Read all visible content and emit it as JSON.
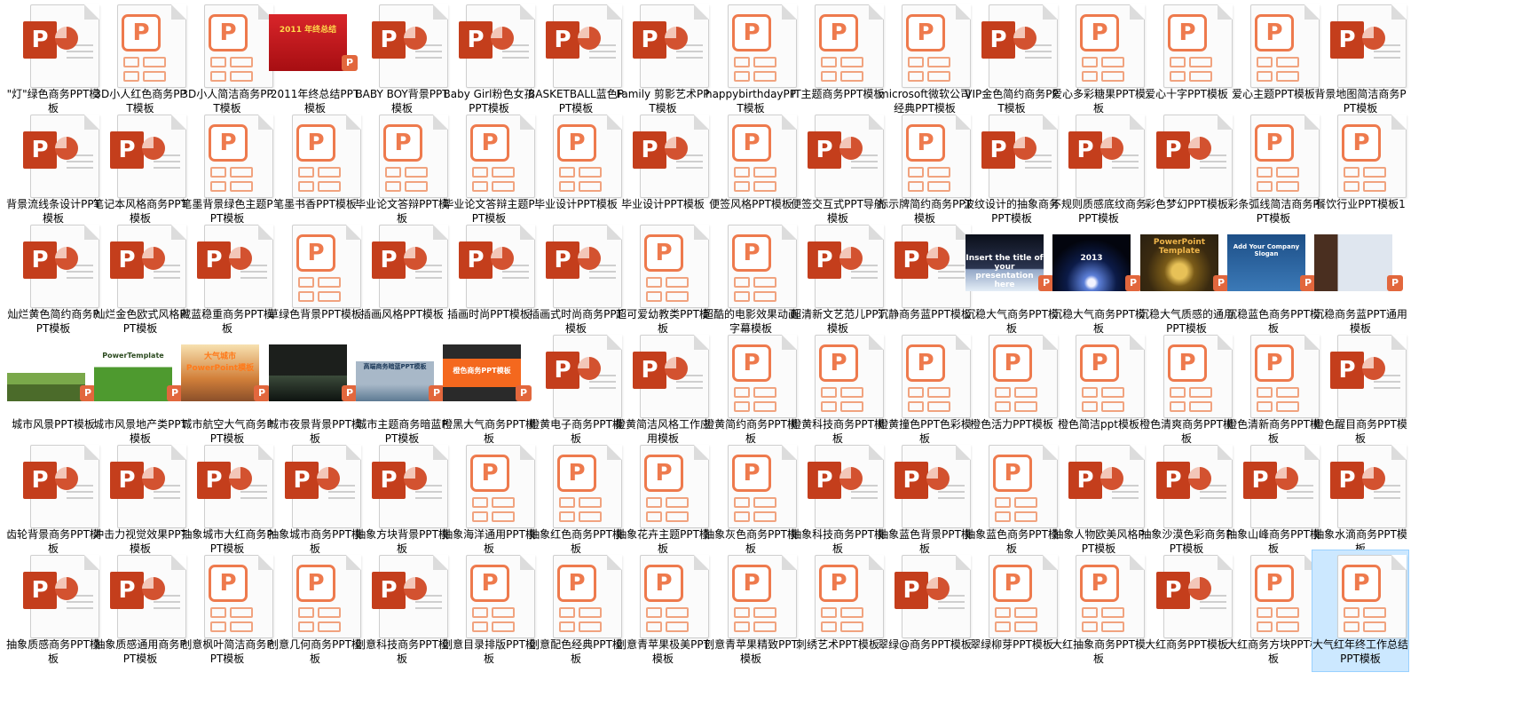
{
  "explorer": {
    "view": "large-icons",
    "items": [
      {
        "label": "\"灯\"绿色商务PPT模板",
        "icon": "ppt-icon"
      },
      {
        "label": "3D小人红色商务PPT模板",
        "icon": "ppt-outline-icon"
      },
      {
        "label": "3D小人简洁商务PPT模板",
        "icon": "ppt-outline-icon"
      },
      {
        "label": "2011年终总结PPT模板",
        "icon": "thumb",
        "theme": "t-red",
        "thumb_text": "2011 年终总结"
      },
      {
        "label": "BABY BOY背景PPT模板",
        "icon": "ppt-icon"
      },
      {
        "label": "Baby Girl粉色女孩PPT模板",
        "icon": "ppt-icon"
      },
      {
        "label": "BASKETBALL蓝色PPT模板",
        "icon": "ppt-icon"
      },
      {
        "label": "Family 剪影艺术PPT模板",
        "icon": "ppt-icon"
      },
      {
        "label": "happybirthdayPPT模板",
        "icon": "ppt-outline-icon"
      },
      {
        "label": "IT主题商务PPT模板",
        "icon": "ppt-outline-icon"
      },
      {
        "label": "microsoft微软公司经典PPT模板",
        "icon": "ppt-outline-icon"
      },
      {
        "label": "VIP金色简约商务PPT模板",
        "icon": "ppt-icon"
      },
      {
        "label": "爱心多彩糖果PPT模板",
        "icon": "ppt-outline-icon"
      },
      {
        "label": "爱心十字PPT模板",
        "icon": "ppt-outline-icon"
      },
      {
        "label": "爱心主题PPT模板",
        "icon": "ppt-outline-icon"
      },
      {
        "label": "背景地图简洁商务PPT模板",
        "icon": "ppt-icon"
      },
      {
        "label": "背景流线条设计PPT模板",
        "icon": "ppt-icon"
      },
      {
        "label": "笔记本风格商务PPT模板",
        "icon": "ppt-icon"
      },
      {
        "label": "笔墨背景绿色主题PPT模板",
        "icon": "ppt-outline-icon"
      },
      {
        "label": "笔墨书香PPT模板",
        "icon": "ppt-outline-icon"
      },
      {
        "label": "毕业论文答辩PPT模板",
        "icon": "ppt-outline-icon"
      },
      {
        "label": "毕业论文答辩主题PPT模板",
        "icon": "ppt-outline-icon"
      },
      {
        "label": "毕业设计PPT模板",
        "icon": "ppt-outline-icon"
      },
      {
        "label": "毕业设计PPT模板",
        "icon": "ppt-icon"
      },
      {
        "label": "便签风格PPT模板",
        "icon": "ppt-outline-icon"
      },
      {
        "label": "便签交互式PPT导航模板",
        "icon": "ppt-icon"
      },
      {
        "label": "标示牌简约商务PPT模板",
        "icon": "ppt-outline-icon"
      },
      {
        "label": "波纹设计的抽象商务PPT模板",
        "icon": "ppt-icon"
      },
      {
        "label": "不规则质感底纹商务PPT模板",
        "icon": "ppt-icon"
      },
      {
        "label": "彩色梦幻PPT模板",
        "icon": "ppt-icon"
      },
      {
        "label": "彩条弧线简洁商务PPT模板",
        "icon": "ppt-outline-icon"
      },
      {
        "label": "餐饮行业PPT模板1",
        "icon": "ppt-outline-icon"
      },
      {
        "label": "灿烂黄色简约商务PPT模板",
        "icon": "ppt-icon"
      },
      {
        "label": "灿烂金色欧式风格PPT模板",
        "icon": "ppt-icon"
      },
      {
        "label": "藏蓝稳重商务PPT模板",
        "icon": "ppt-icon"
      },
      {
        "label": "草绿色背景PPT模板",
        "icon": "ppt-outline-icon"
      },
      {
        "label": "插画风格PPT模板",
        "icon": "ppt-icon"
      },
      {
        "label": "插画时尚PPT模板",
        "icon": "ppt-icon"
      },
      {
        "label": "插画式时尚商务PPT模板",
        "icon": "ppt-icon"
      },
      {
        "label": "超可爱幼教类PPT模板",
        "icon": "ppt-outline-icon"
      },
      {
        "label": "超酷的电影效果动画字幕模板",
        "icon": "ppt-outline-icon"
      },
      {
        "label": "超清新文艺范儿PPT模板",
        "icon": "ppt-icon"
      },
      {
        "label": "沉静商务蓝PPT模板",
        "icon": "ppt-icon"
      },
      {
        "label": "沉稳大气商务PPT模板",
        "icon": "thumb",
        "theme": "t-dark",
        "thumb_text": "Insert the title of your presentation here"
      },
      {
        "label": "沉稳大气商务PPT模板",
        "icon": "thumb",
        "theme": "t-space",
        "thumb_text": "2013"
      },
      {
        "label": "沉稳大气质感的通用PPT模板",
        "icon": "thumb",
        "theme": "t-gold",
        "thumb_text": "PowerPoint Template"
      },
      {
        "label": "沉稳蓝色商务PPT模板",
        "icon": "thumb",
        "theme": "t-blue",
        "thumb_text": "Add Your Company Slogan"
      },
      {
        "label": "沉稳商务蓝PPT通用模板",
        "icon": "thumb",
        "theme": "t-biz",
        "thumb_text": ""
      },
      {
        "label": "城市风景PPT模板",
        "icon": "thumb",
        "theme": "t-tree",
        "thumb_text": ""
      },
      {
        "label": "城市风景地产类PPT模板",
        "icon": "thumb",
        "theme": "t-city",
        "thumb_text": "PowerTemplate"
      },
      {
        "label": "城市航空大气商务PPT模板",
        "icon": "thumb",
        "theme": "t-air",
        "thumb_text": "大气城市PowerPoint模板"
      },
      {
        "label": "城市夜景背景PPT模板",
        "icon": "thumb",
        "theme": "t-night",
        "thumb_text": ""
      },
      {
        "label": "城市主题商务暗蓝PPT模板",
        "icon": "thumb",
        "theme": "t-tower",
        "thumb_text": "高端商务暗蓝PPT模板"
      },
      {
        "label": "橙黑大气商务PPT模板",
        "icon": "thumb",
        "theme": "t-orange",
        "thumb_text": "橙色商务PPT模板"
      },
      {
        "label": "橙黄电子商务PPT模板",
        "icon": "ppt-icon"
      },
      {
        "label": "橙黄简洁风格工作应用模板",
        "icon": "ppt-icon"
      },
      {
        "label": "橙黄简约商务PPT模板",
        "icon": "ppt-outline-icon"
      },
      {
        "label": "橙黄科技商务PPT模板",
        "icon": "ppt-outline-icon"
      },
      {
        "label": "橙黄撞色PPT色彩模板",
        "icon": "ppt-outline-icon"
      },
      {
        "label": "橙色活力PPT模板",
        "icon": "ppt-outline-icon"
      },
      {
        "label": "橙色简洁ppt模板",
        "icon": "ppt-outline-icon"
      },
      {
        "label": "橙色清爽商务PPT模板",
        "icon": "ppt-outline-icon"
      },
      {
        "label": "橙色清新商务PPT模板",
        "icon": "ppt-outline-icon"
      },
      {
        "label": "橙色醒目商务PPT模板",
        "icon": "ppt-icon"
      },
      {
        "label": "齿轮背景商务PPT模板",
        "icon": "ppt-icon"
      },
      {
        "label": "冲击力视觉效果PPT模板",
        "icon": "ppt-icon"
      },
      {
        "label": "抽象城市大红商务PPT模板",
        "icon": "ppt-icon"
      },
      {
        "label": "抽象城市商务PPT模板",
        "icon": "ppt-icon"
      },
      {
        "label": "抽象方块背景PPT模板",
        "icon": "ppt-icon"
      },
      {
        "label": "抽象海洋通用PPT模板",
        "icon": "ppt-outline-icon"
      },
      {
        "label": "抽象红色商务PPT模板",
        "icon": "ppt-outline-icon"
      },
      {
        "label": "抽象花卉主题PPT模板",
        "icon": "ppt-outline-icon"
      },
      {
        "label": "抽象灰色商务PPT模板",
        "icon": "ppt-outline-icon"
      },
      {
        "label": "抽象科技商务PPT模板",
        "icon": "ppt-icon"
      },
      {
        "label": "抽象蓝色背景PPT模板",
        "icon": "ppt-icon"
      },
      {
        "label": "抽象蓝色商务PPT模板",
        "icon": "ppt-outline-icon"
      },
      {
        "label": "抽象人物欧美风格PPT模板",
        "icon": "ppt-icon"
      },
      {
        "label": "抽象沙漠色彩商务PPT模板",
        "icon": "ppt-icon"
      },
      {
        "label": "抽象山峰商务PPT模板",
        "icon": "ppt-icon"
      },
      {
        "label": "抽象水滴商务PPT模板",
        "icon": "ppt-icon"
      },
      {
        "label": "抽象质感商务PPT模板",
        "icon": "ppt-icon"
      },
      {
        "label": "抽象质感通用商务PPT模板",
        "icon": "ppt-icon"
      },
      {
        "label": "创意枫叶简洁商务PPT模板",
        "icon": "ppt-outline-icon"
      },
      {
        "label": "创意几何商务PPT模板",
        "icon": "ppt-outline-icon"
      },
      {
        "label": "创意科技商务PPT模板",
        "icon": "ppt-icon"
      },
      {
        "label": "创意目录排版PPT模板",
        "icon": "ppt-outline-icon"
      },
      {
        "label": "创意配色经典PPT模板",
        "icon": "ppt-outline-icon"
      },
      {
        "label": "创意青苹果极美PPT模板",
        "icon": "ppt-outline-icon"
      },
      {
        "label": "创意青苹果精致PPT模板",
        "icon": "ppt-outline-icon"
      },
      {
        "label": "刺绣艺术PPT模板",
        "icon": "ppt-outline-icon"
      },
      {
        "label": "翠绿@商务PPT模板",
        "icon": "ppt-icon"
      },
      {
        "label": "翠绿柳芽PPT模板",
        "icon": "ppt-outline-icon"
      },
      {
        "label": "大红抽象商务PPT模板",
        "icon": "ppt-outline-icon"
      },
      {
        "label": "大红商务PPT模板",
        "icon": "ppt-icon"
      },
      {
        "label": "大红商务方块PPT模板",
        "icon": "ppt-outline-icon"
      },
      {
        "label": "大气红年终工作总结PPT模板",
        "icon": "ppt-outline-icon",
        "selected": true
      }
    ]
  }
}
